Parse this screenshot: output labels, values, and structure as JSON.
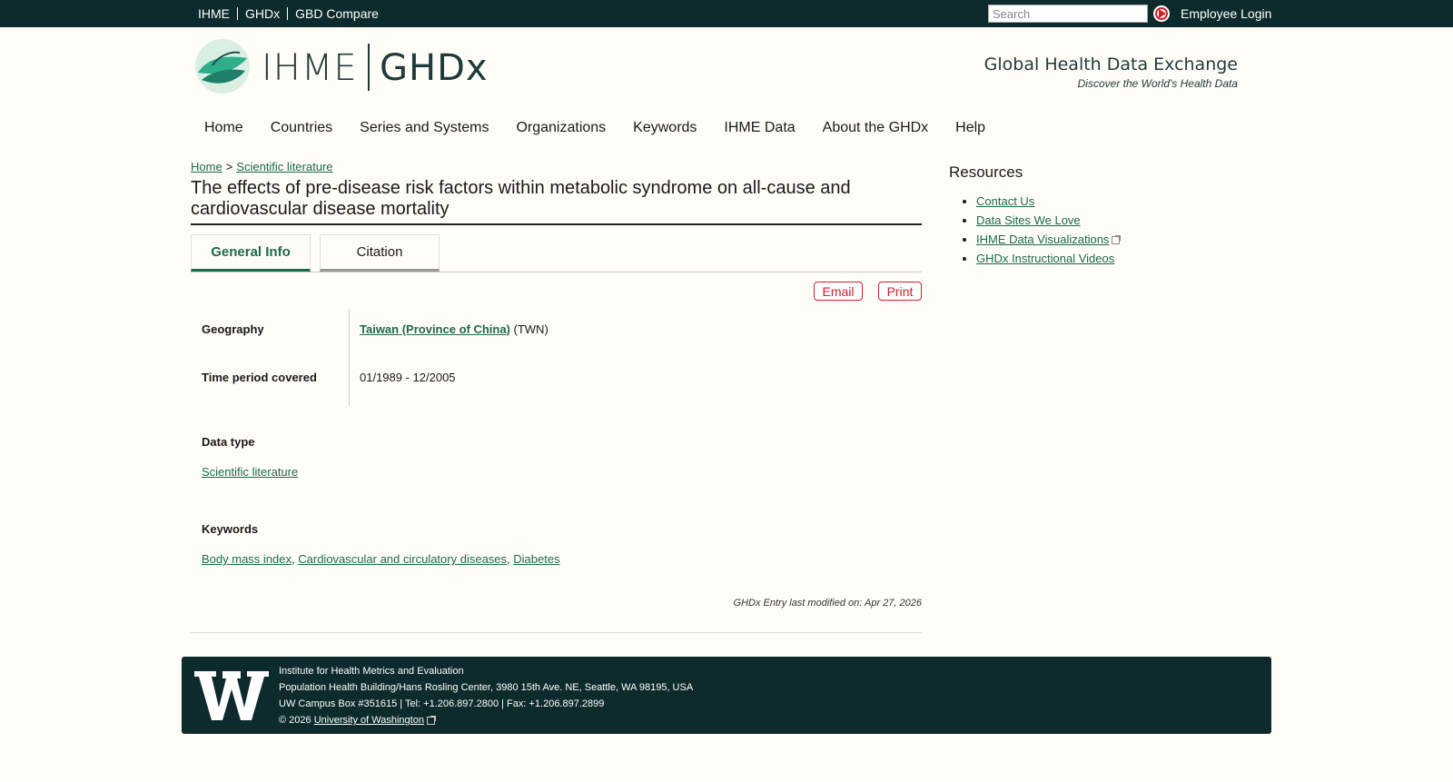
{
  "topbar": {
    "links": [
      "IHME",
      "GHDx",
      "GBD Compare"
    ],
    "search_placeholder": "Search",
    "employee_login": "Employee Login"
  },
  "header": {
    "ihme_logo_text": "IHME",
    "ghdx_logo_text": "GHDx",
    "tagline_title": "Global Health Data Exchange",
    "tagline_sub": "Discover the World's Health Data"
  },
  "mainnav": [
    "Home",
    "Countries",
    "Series and Systems",
    "Organizations",
    "Keywords",
    "IHME Data",
    "About the GHDx",
    "Help"
  ],
  "breadcrumb": {
    "home": "Home",
    "sep": ">",
    "current": "Scientific literature"
  },
  "page_title": "The effects of pre-disease risk factors within metabolic syndrome on all-cause and cardiovascular disease mortality",
  "tabs": {
    "general": "General Info",
    "citation": "Citation"
  },
  "actions": {
    "email": "Email",
    "print": "Print"
  },
  "details": {
    "geography_label": "Geography",
    "geography_link": "Taiwan (Province of China)",
    "geography_code": "(TWN)",
    "time_label": "Time period covered",
    "time_value": "01/1989 - 12/2005",
    "data_type_label": "Data type",
    "data_type_value": "Scientific literature",
    "keywords_label": "Keywords",
    "keywords": [
      "Body mass index",
      "Cardiovascular and circulatory diseases",
      "Diabetes"
    ],
    "keyword_sep": ","
  },
  "modified": "GHDx Entry last modified on: Apr 27, 2026",
  "resources": {
    "title": "Resources",
    "items": [
      "Contact Us",
      "Data Sites We Love",
      "IHME Data Visualizations",
      "GHDx Instructional Videos"
    ]
  },
  "footer": {
    "line1": "Institute for Health Metrics and Evaluation",
    "line2": "Population Health Building/Hans Rosling Center, 3980 15th Ave. NE, Seattle, WA 98195, USA",
    "line3": "UW Campus Box #351615 | Tel: +1.206.897.2800 | Fax: +1.206.897.2899",
    "copyright": "© 2026",
    "uw_link": "University of Washington"
  },
  "colors": {
    "topbar": "#0d2b2c",
    "link": "#1b6b4a",
    "accent_red": "#d0202a",
    "background": "#fffdf7"
  }
}
